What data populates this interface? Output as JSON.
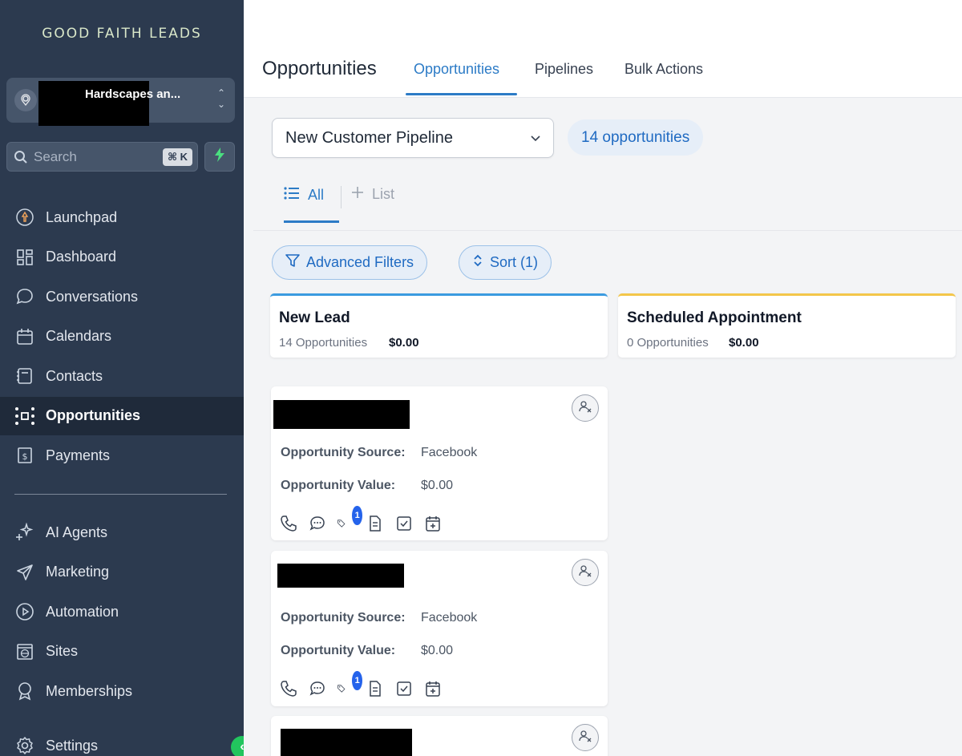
{
  "sidebar": {
    "logo": "GOOD FAITH LEADS",
    "account_name": "Hardscapes an...",
    "search": {
      "placeholder": "Search",
      "shortcut": "⌘ K"
    },
    "items": [
      {
        "label": "Launchpad",
        "icon": "rocket-icon"
      },
      {
        "label": "Dashboard",
        "icon": "grid-icon"
      },
      {
        "label": "Conversations",
        "icon": "chat-icon"
      },
      {
        "label": "Calendars",
        "icon": "calendar-icon"
      },
      {
        "label": "Contacts",
        "icon": "contacts-icon"
      },
      {
        "label": "Opportunities",
        "icon": "opportunities-icon",
        "active": true
      },
      {
        "label": "Payments",
        "icon": "payments-icon"
      }
    ],
    "items2": [
      {
        "label": "AI Agents",
        "icon": "sparkle-icon"
      },
      {
        "label": "Marketing",
        "icon": "send-icon"
      },
      {
        "label": "Automation",
        "icon": "play-circle-icon"
      },
      {
        "label": "Sites",
        "icon": "globe-window-icon"
      },
      {
        "label": "Memberships",
        "icon": "award-icon"
      },
      {
        "label": "Settings",
        "icon": "gear-icon"
      }
    ]
  },
  "header": {
    "title": "Opportunities",
    "tabs": [
      {
        "label": "Opportunities",
        "active": true
      },
      {
        "label": "Pipelines"
      },
      {
        "label": "Bulk Actions"
      }
    ]
  },
  "main": {
    "pipeline": "New Customer Pipeline",
    "count_label": "14 opportunities",
    "views": {
      "all": "All",
      "list": "List"
    },
    "filters": {
      "advanced": "Advanced Filters",
      "sort": "Sort (1)"
    },
    "stages": [
      {
        "name": "New Lead",
        "count": "14 Opportunities",
        "amount": "$0.00",
        "color": "#3b9be0"
      },
      {
        "name": "Scheduled Appointment",
        "count": "0 Opportunities",
        "amount": "$0.00",
        "color": "#f3c64a"
      }
    ],
    "cards": [
      {
        "source_label": "Opportunity Source:",
        "source": "Facebook",
        "value_label": "Opportunity Value:",
        "value": "$0.00",
        "tag_badge": "1"
      },
      {
        "source_label": "Opportunity Source:",
        "source": "Facebook",
        "value_label": "Opportunity Value:",
        "value": "$0.00",
        "tag_badge": "1"
      }
    ]
  }
}
